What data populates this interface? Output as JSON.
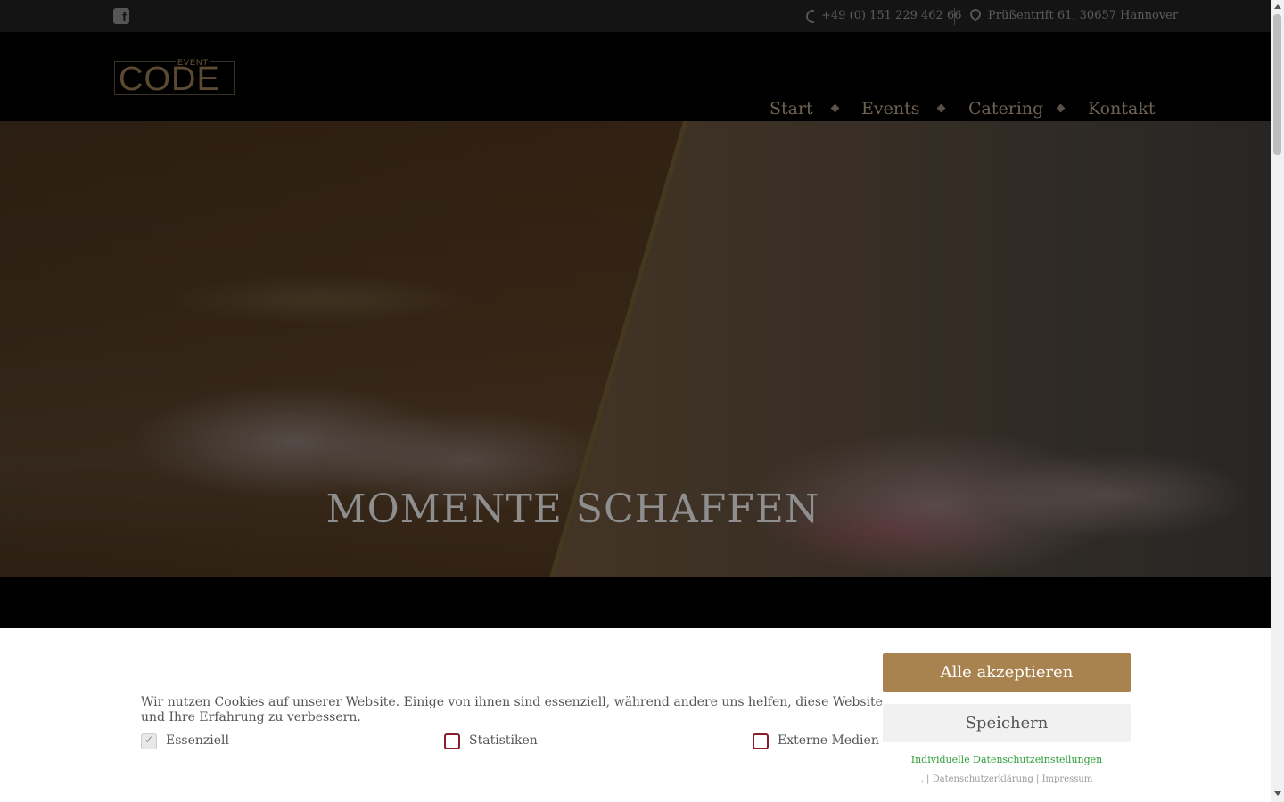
{
  "topbar": {
    "phone": "+49 (0) 151 229 462 66",
    "address": "Prüßentrift 61, 30657 Hannover"
  },
  "logo": {
    "top": "EVENT",
    "main": "CODE"
  },
  "nav": {
    "items": [
      {
        "label": "Start"
      },
      {
        "label": "Events"
      },
      {
        "label": "Catering"
      },
      {
        "label": "Kontakt"
      }
    ]
  },
  "hero": {
    "title": "MOMENTE SCHAFFEN"
  },
  "cookie": {
    "text": "Wir nutzen Cookies auf unserer Website. Einige von ihnen sind essenziell, während andere uns helfen, diese Website und Ihre Erfahrung zu verbessern.",
    "options": [
      {
        "label": "Essenziell",
        "checked": true,
        "disabled": true
      },
      {
        "label": "Statistiken",
        "checked": false,
        "disabled": false
      },
      {
        "label": "Externe Medien",
        "checked": false,
        "disabled": false
      }
    ],
    "accept_all": "Alle akzeptieren",
    "save": "Speichern",
    "individual": "Individuelle Datenschutzeinstellungen",
    "dot": ".",
    "privacy": "Datenschutzerklärung",
    "imprint": "Impressum"
  },
  "colors": {
    "accent": "#a8834f",
    "checkbox_border": "#8b1c2c",
    "link_green": "#2e9e3c"
  }
}
